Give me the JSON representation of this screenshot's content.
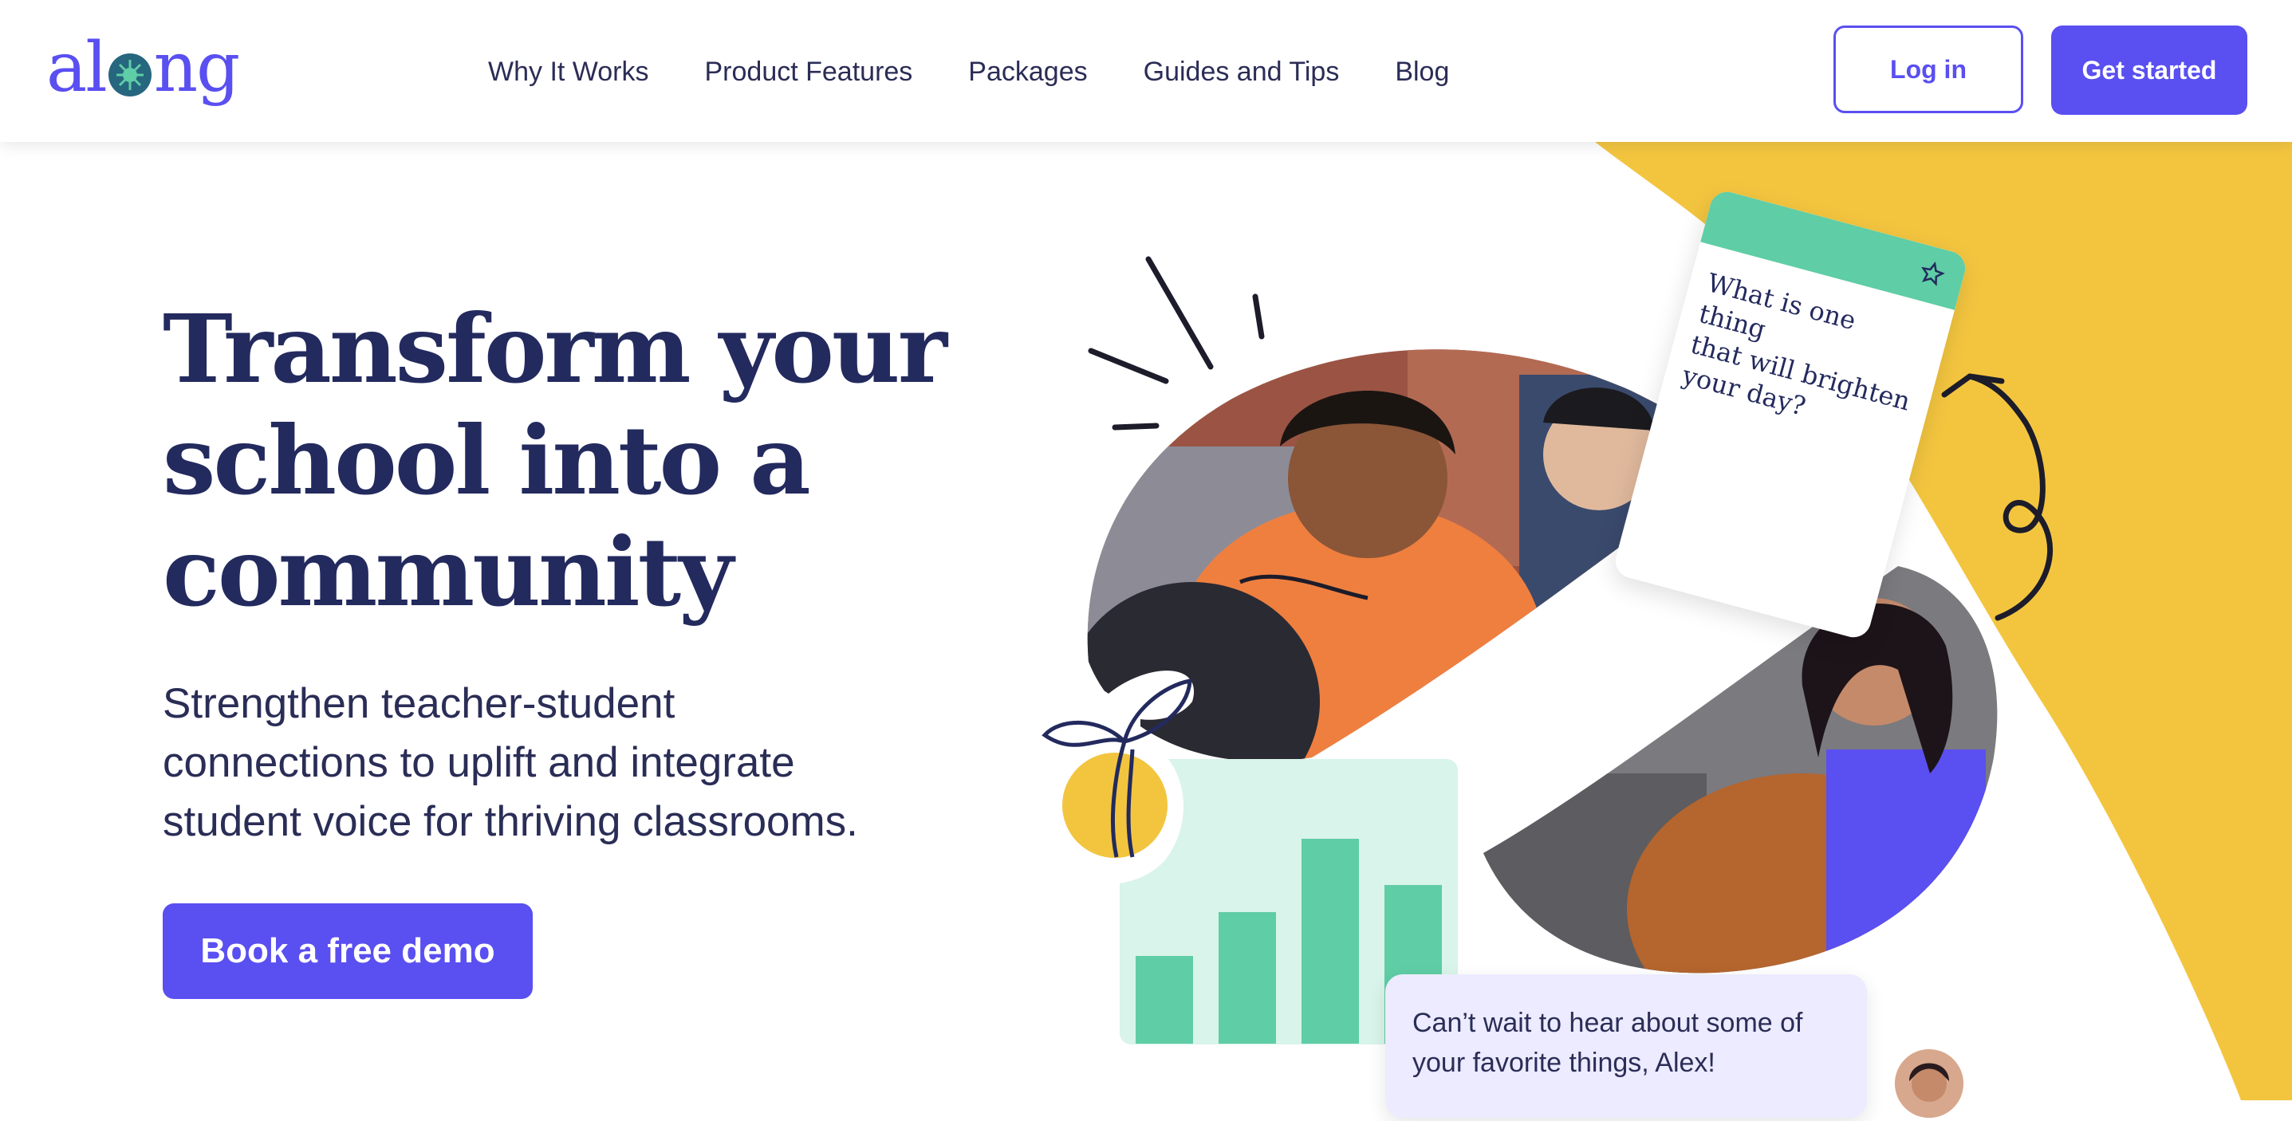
{
  "brand": {
    "name": "along",
    "accent": "#5a4ff0",
    "navy": "#232a5e",
    "mint": "#5fcda5",
    "yellow": "#f3c53f"
  },
  "nav": {
    "items": [
      "Why It Works",
      "Product Features",
      "Packages",
      "Guides and Tips",
      "Blog"
    ],
    "login_label": "Log in",
    "get_started_label": "Get started"
  },
  "hero": {
    "title_lines": [
      "Transform your",
      "school into a",
      "community"
    ],
    "subtitle_lines": [
      "Strengthen teacher-student",
      "connections to uplift and integrate",
      "student voice for thriving classrooms."
    ],
    "cta_label": "Book a free demo"
  },
  "question_card": {
    "lines": [
      "What is one thing",
      "that will brighten",
      "your day?"
    ],
    "icon": "star-icon"
  },
  "message": {
    "lines": [
      "Can’t wait to hear about some of",
      "your favorite things, Alex!"
    ]
  }
}
